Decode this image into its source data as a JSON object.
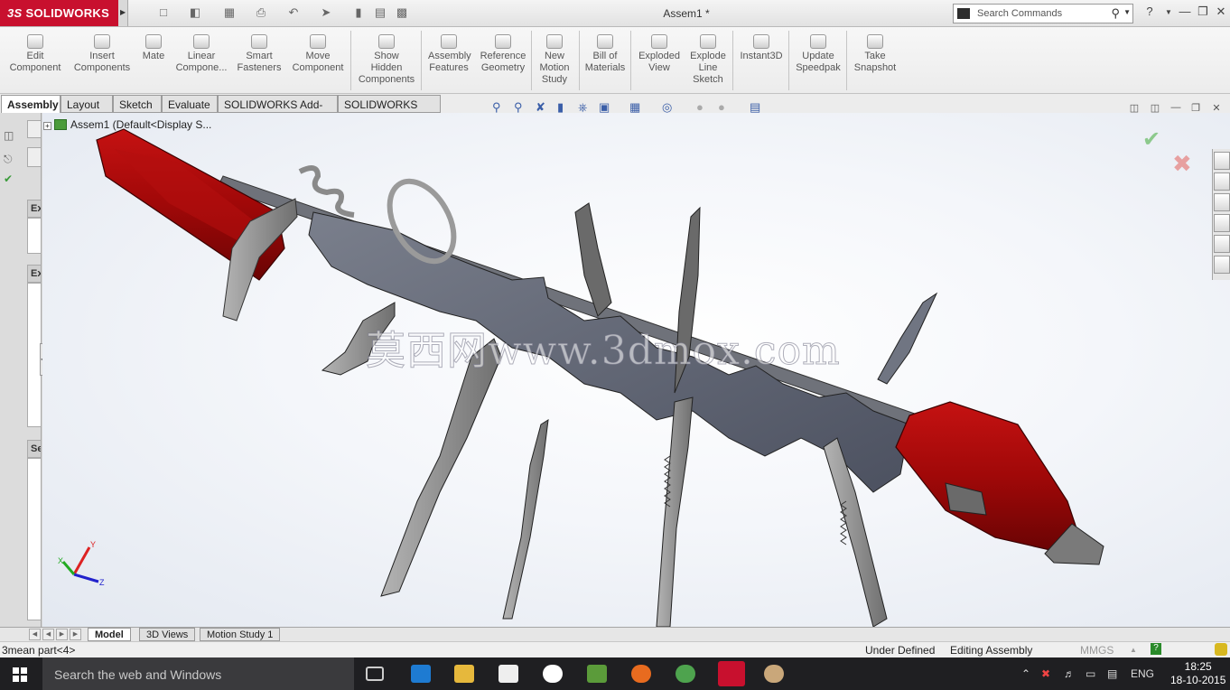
{
  "app": {
    "brand": "SOLIDWORKS",
    "brand_prefix": "3S",
    "document_title": "Assem1 *",
    "search_placeholder": "Search Commands",
    "help_symbol": "?"
  },
  "command_manager": {
    "items": [
      {
        "label": "Edit\nComponent",
        "icon": "edit-component-icon"
      },
      {
        "label": "Insert\nComponents",
        "icon": "insert-components-icon"
      },
      {
        "label": "Mate",
        "icon": "mate-icon"
      },
      {
        "label": "Linear\nCompone...",
        "icon": "linear-pattern-icon"
      },
      {
        "label": "Smart\nFasteners",
        "icon": "smart-fasteners-icon"
      },
      {
        "label": "Move\nComponent",
        "icon": "move-component-icon"
      },
      {
        "label": "Show\nHidden\nComponents",
        "icon": "show-hidden-icon"
      },
      {
        "label": "Assembly\nFeatures",
        "icon": "assembly-features-icon"
      },
      {
        "label": "Reference\nGeometry",
        "icon": "reference-geometry-icon"
      },
      {
        "label": "New\nMotion\nStudy",
        "icon": "motion-study-icon"
      },
      {
        "label": "Bill of\nMaterials",
        "icon": "bom-icon"
      },
      {
        "label": "Exploded\nView",
        "icon": "exploded-view-icon"
      },
      {
        "label": "Explode\nLine\nSketch",
        "icon": "explode-line-icon"
      },
      {
        "label": "Instant3D",
        "icon": "instant3d-icon"
      },
      {
        "label": "Update\nSpeedpak",
        "icon": "speedpak-icon"
      },
      {
        "label": "Take\nSnapshot",
        "icon": "snapshot-icon"
      }
    ]
  },
  "tabs": [
    {
      "label": "Assembly",
      "active": true
    },
    {
      "label": "Layout",
      "active": false
    },
    {
      "label": "Sketch",
      "active": false
    },
    {
      "label": "Evaluate",
      "active": false
    },
    {
      "label": "SOLIDWORKS Add-Ins",
      "active": false
    },
    {
      "label": "SOLIDWORKS MBD",
      "active": false
    }
  ],
  "feature_tree": {
    "root_label": "Assem1  (Default<Display S...",
    "panel_heads": [
      "Ex",
      "Ex",
      "Se"
    ]
  },
  "viewport": {
    "watermark": "莫西网www.3dmox.com",
    "triad": {
      "x": "X",
      "y": "Y",
      "z": "Z"
    }
  },
  "bottom_tabs": [
    {
      "label": "Model",
      "active": true
    },
    {
      "label": "3D Views",
      "active": false
    },
    {
      "label": "Motion Study 1",
      "active": false
    }
  ],
  "status": {
    "selection": "3mean part<4>",
    "definition": "Under Defined",
    "mode": "Editing Assembly",
    "units": "MMGS",
    "units_arrow": "▲"
  },
  "taskbar": {
    "search_text": "Search the web and Windows",
    "language": "ENG",
    "time": "18:25",
    "date": "18-10-2015",
    "icons": [
      "task-view-icon",
      "edge-icon",
      "file-explorer-icon",
      "store-icon",
      "hp-icon",
      "calculator-icon",
      "firefox-icon",
      "utorrent-icon",
      "solidworks-taskbar-icon",
      "paint-icon"
    ]
  },
  "colors": {
    "brand_red": "#c8102e",
    "handle_red": "#9e0a0a",
    "blade_gray": "#6a6e7a",
    "taskbar": "#1f1f22"
  }
}
